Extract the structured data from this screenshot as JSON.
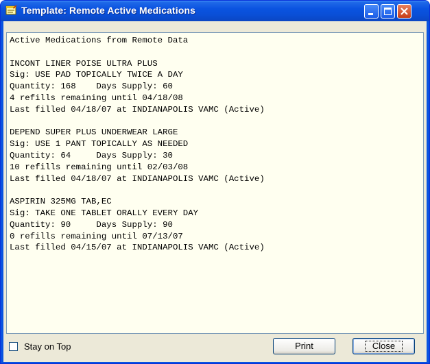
{
  "window": {
    "title": "Template: Remote Active Medications",
    "icon": "template-notepad-icon"
  },
  "content": {
    "lines": [
      "Active Medications from Remote Data",
      "",
      "INCONT LINER POISE ULTRA PLUS",
      "Sig: USE PAD TOPICALLY TWICE A DAY",
      "Quantity: 168    Days Supply: 60",
      "4 refills remaining until 04/18/08",
      "Last filled 04/18/07 at INDIANAPOLIS VAMC (Active)",
      "",
      "DEPEND SUPER PLUS UNDERWEAR LARGE",
      "Sig: USE 1 PANT TOPICALLY AS NEEDED",
      "Quantity: 64     Days Supply: 30",
      "10 refills remaining until 02/03/08",
      "Last filled 04/18/07 at INDIANAPOLIS VAMC (Active)",
      "",
      "ASPIRIN 325MG TAB,EC",
      "Sig: TAKE ONE TABLET ORALLY EVERY DAY",
      "Quantity: 90     Days Supply: 90",
      "0 refills remaining until 07/13/07",
      "Last filled 04/15/07 at INDIANAPOLIS VAMC (Active)"
    ]
  },
  "footer": {
    "stay_on_top_label": "Stay on Top",
    "stay_on_top_checked": false,
    "print_label": "Print",
    "close_label": "Close"
  }
}
